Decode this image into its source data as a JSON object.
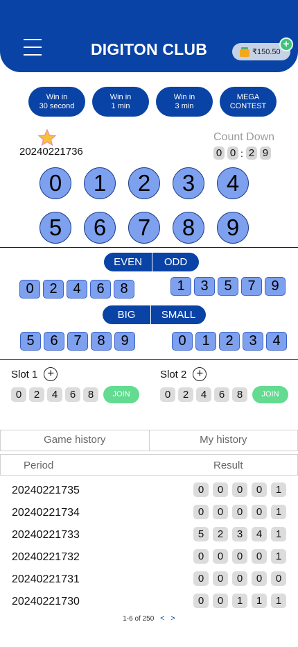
{
  "header": {
    "title": "DIGITON CLUB",
    "wallet_balance": "₹150.50",
    "wallet_add": "+"
  },
  "game_tabs": [
    {
      "line1": "Win in",
      "line2": "30 second"
    },
    {
      "line1": "Win in",
      "line2": "1 min"
    },
    {
      "line1": "Win in",
      "line2": "3 min"
    },
    {
      "line1": "MEGA",
      "line2": "CONTEST"
    }
  ],
  "round": {
    "period": "20240221736",
    "countdown_label": "Count Down",
    "countdown_digits": [
      "0",
      "0",
      "2",
      "9"
    ],
    "countdown_separator": ":"
  },
  "number_balls": [
    "0",
    "1",
    "2",
    "3",
    "4",
    "5",
    "6",
    "7",
    "8",
    "9"
  ],
  "even_odd": {
    "even_label": "EVEN",
    "odd_label": "ODD",
    "even_numbers": [
      "0",
      "2",
      "4",
      "6",
      "8"
    ],
    "odd_numbers": [
      "1",
      "3",
      "5",
      "7",
      "9"
    ]
  },
  "big_small": {
    "big_label": "BIG",
    "small_label": "SMALL",
    "big_numbers": [
      "5",
      "6",
      "7",
      "8",
      "9"
    ],
    "small_numbers": [
      "0",
      "1",
      "2",
      "3",
      "4"
    ]
  },
  "slots": [
    {
      "label": "Slot 1",
      "numbers": [
        "0",
        "2",
        "4",
        "6",
        "8"
      ],
      "join_label": "JOIN"
    },
    {
      "label": "Slot 2",
      "numbers": [
        "0",
        "2",
        "4",
        "6",
        "8"
      ],
      "join_label": "JOIN"
    }
  ],
  "history": {
    "tab_game": "Game history",
    "tab_my": "My history",
    "col_period": "Period",
    "col_result": "Result",
    "rows": [
      {
        "period": "20240221735",
        "result": [
          "0",
          "0",
          "0",
          "0",
          "1"
        ]
      },
      {
        "period": "20240221734",
        "result": [
          "0",
          "0",
          "0",
          "0",
          "1"
        ]
      },
      {
        "period": "20240221733",
        "result": [
          "5",
          "2",
          "3",
          "4",
          "1"
        ]
      },
      {
        "period": "20240221732",
        "result": [
          "0",
          "0",
          "0",
          "0",
          "1"
        ]
      },
      {
        "period": "20240221731",
        "result": [
          "0",
          "0",
          "0",
          "0",
          "0"
        ]
      },
      {
        "period": "20240221730",
        "result": [
          "0",
          "0",
          "1",
          "1",
          "1"
        ]
      }
    ]
  },
  "pagination": {
    "text": "1-6 of 250",
    "prev": "<",
    "next": ">"
  },
  "colors": {
    "primary": "#0a43a6",
    "ball": "#7da0ef",
    "join": "#63db90",
    "chip_grey": "#dcdcdc"
  },
  "icons": [
    "menu-icon",
    "wallet-icon",
    "plus-circle-icon",
    "star-icon"
  ]
}
